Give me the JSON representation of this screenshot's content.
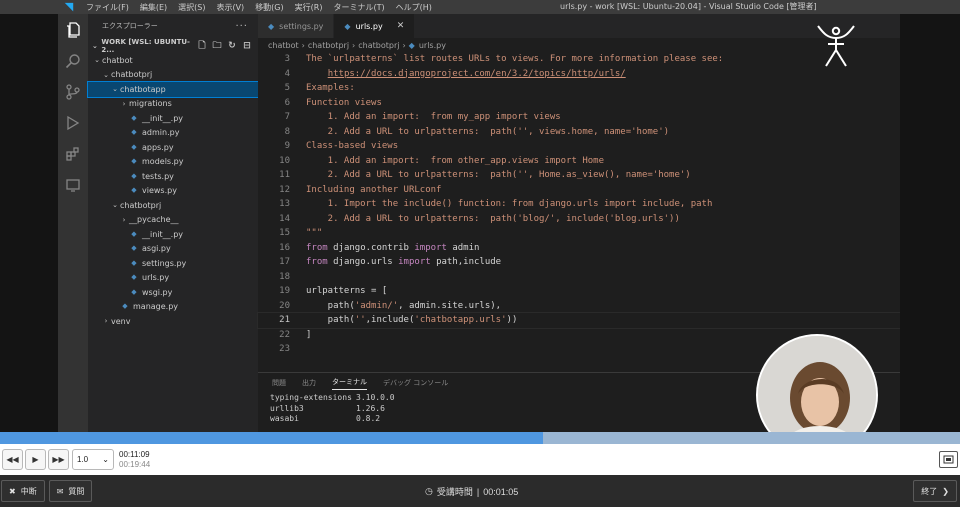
{
  "titlebar": {
    "menus": [
      "ファイル(F)",
      "編集(E)",
      "選択(S)",
      "表示(V)",
      "移動(G)",
      "実行(R)",
      "ターミナル(T)",
      "ヘルプ(H)"
    ],
    "window_title": "urls.py - work [WSL: Ubuntu-20.04] - Visual Studio Code [管理者]"
  },
  "sidebar": {
    "title": "エクスプローラー",
    "more": "···",
    "workspace": "WORK [WSL: UBUNTU-2...",
    "tree": [
      {
        "label": "chatbot",
        "indent": 0,
        "kind": "folder-open"
      },
      {
        "label": "chatbotprj",
        "indent": 1,
        "kind": "folder-open"
      },
      {
        "label": "chatbotapp",
        "indent": 2,
        "kind": "folder-open",
        "selected": true
      },
      {
        "label": "migrations",
        "indent": 3,
        "kind": "folder-closed"
      },
      {
        "label": "__init__.py",
        "indent": 3,
        "kind": "py"
      },
      {
        "label": "admin.py",
        "indent": 3,
        "kind": "py"
      },
      {
        "label": "apps.py",
        "indent": 3,
        "kind": "py"
      },
      {
        "label": "models.py",
        "indent": 3,
        "kind": "py"
      },
      {
        "label": "tests.py",
        "indent": 3,
        "kind": "py"
      },
      {
        "label": "views.py",
        "indent": 3,
        "kind": "py"
      },
      {
        "label": "chatbotprj",
        "indent": 2,
        "kind": "folder-open"
      },
      {
        "label": "__pycache__",
        "indent": 3,
        "kind": "folder-closed"
      },
      {
        "label": "__init__.py",
        "indent": 3,
        "kind": "py"
      },
      {
        "label": "asgi.py",
        "indent": 3,
        "kind": "py"
      },
      {
        "label": "settings.py",
        "indent": 3,
        "kind": "py"
      },
      {
        "label": "urls.py",
        "indent": 3,
        "kind": "py"
      },
      {
        "label": "wsgi.py",
        "indent": 3,
        "kind": "py"
      },
      {
        "label": "manage.py",
        "indent": 2,
        "kind": "py"
      },
      {
        "label": "venv",
        "indent": 1,
        "kind": "folder-closed"
      }
    ]
  },
  "editor": {
    "tabs": [
      {
        "label": "settings.py",
        "active": false
      },
      {
        "label": "urls.py",
        "active": true,
        "close": "✕"
      }
    ],
    "breadcrumb": [
      "chatbot",
      "chatbotprj",
      "chatbotprj",
      "urls.py"
    ],
    "current_line": 21,
    "lines": [
      {
        "n": 3,
        "tokens": [
          [
            "s",
            "The `urlpatterns` list routes URLs to views. For more information please see:"
          ]
        ]
      },
      {
        "n": 4,
        "tokens": [
          [
            "s",
            "    "
          ],
          [
            "l",
            "https://docs.djangoproject.com/en/3.2/topics/http/urls/"
          ]
        ]
      },
      {
        "n": 5,
        "tokens": [
          [
            "s",
            "Examples:"
          ]
        ]
      },
      {
        "n": 6,
        "tokens": [
          [
            "s",
            "Function views"
          ]
        ]
      },
      {
        "n": 7,
        "tokens": [
          [
            "s",
            "    1. Add an import:  from my_app import views"
          ]
        ]
      },
      {
        "n": 8,
        "tokens": [
          [
            "s",
            "    2. Add a URL to urlpatterns:  path('', views.home, name='home')"
          ]
        ]
      },
      {
        "n": 9,
        "tokens": [
          [
            "s",
            "Class-based views"
          ]
        ]
      },
      {
        "n": 10,
        "tokens": [
          [
            "s",
            "    1. Add an import:  from other_app.views import Home"
          ]
        ]
      },
      {
        "n": 11,
        "tokens": [
          [
            "s",
            "    2. Add a URL to urlpatterns:  path('', Home.as_view(), name='home')"
          ]
        ]
      },
      {
        "n": 12,
        "tokens": [
          [
            "s",
            "Including another URLconf"
          ]
        ]
      },
      {
        "n": 13,
        "tokens": [
          [
            "s",
            "    1. Import the include() function: from django.urls import include, path"
          ]
        ]
      },
      {
        "n": 14,
        "tokens": [
          [
            "s",
            "    2. Add a URL to urlpatterns:  path('blog/', include('blog.urls'))"
          ]
        ]
      },
      {
        "n": 15,
        "tokens": [
          [
            "s",
            "\"\"\""
          ]
        ]
      },
      {
        "n": 16,
        "tokens": [
          [
            "k",
            "from"
          ],
          [
            "p",
            " django.contrib "
          ],
          [
            "k",
            "import"
          ],
          [
            "p",
            " admin"
          ]
        ]
      },
      {
        "n": 17,
        "tokens": [
          [
            "k",
            "from"
          ],
          [
            "p",
            " django.urls "
          ],
          [
            "k",
            "import"
          ],
          [
            "p",
            " path,include"
          ]
        ]
      },
      {
        "n": 18,
        "tokens": []
      },
      {
        "n": 19,
        "tokens": [
          [
            "p",
            "urlpatterns = ["
          ]
        ]
      },
      {
        "n": 20,
        "tokens": [
          [
            "p",
            "    path("
          ],
          [
            "s",
            "'admin/'"
          ],
          [
            "p",
            ", admin.site.urls),"
          ]
        ]
      },
      {
        "n": 21,
        "tokens": [
          [
            "p",
            "    path("
          ],
          [
            "s",
            "''"
          ],
          [
            "p",
            ",include("
          ],
          [
            "s",
            "'chatbotapp.urls'"
          ],
          [
            "p",
            "))"
          ]
        ]
      },
      {
        "n": 22,
        "tokens": [
          [
            "p",
            "]"
          ]
        ]
      },
      {
        "n": 23,
        "tokens": []
      }
    ]
  },
  "panel": {
    "tabs": [
      {
        "label": "問題",
        "active": false
      },
      {
        "label": "出力",
        "active": false
      },
      {
        "label": "ターミナル",
        "active": true
      },
      {
        "label": "デバッグ コンソール",
        "active": false
      }
    ],
    "terminal": [
      {
        "pkg": "typing-extensions",
        "ver": "3.10.0.0"
      },
      {
        "pkg": "urllib3",
        "ver": "1.26.6"
      },
      {
        "pkg": "wasabi",
        "ver": "0.8.2"
      }
    ]
  },
  "player": {
    "progress": 0.566,
    "speed": "1.0",
    "current_time": "00:11:09",
    "total_time": "00:19:44",
    "interrupt_label": "中断",
    "question_label": "質問",
    "study_time_label": "受講時間",
    "study_time_sep": "|",
    "study_time": "00:01:05",
    "finish_label": "終了",
    "colors": {
      "progress_fill": "#4f97e0",
      "progress_track": "#9ab6d3"
    }
  }
}
